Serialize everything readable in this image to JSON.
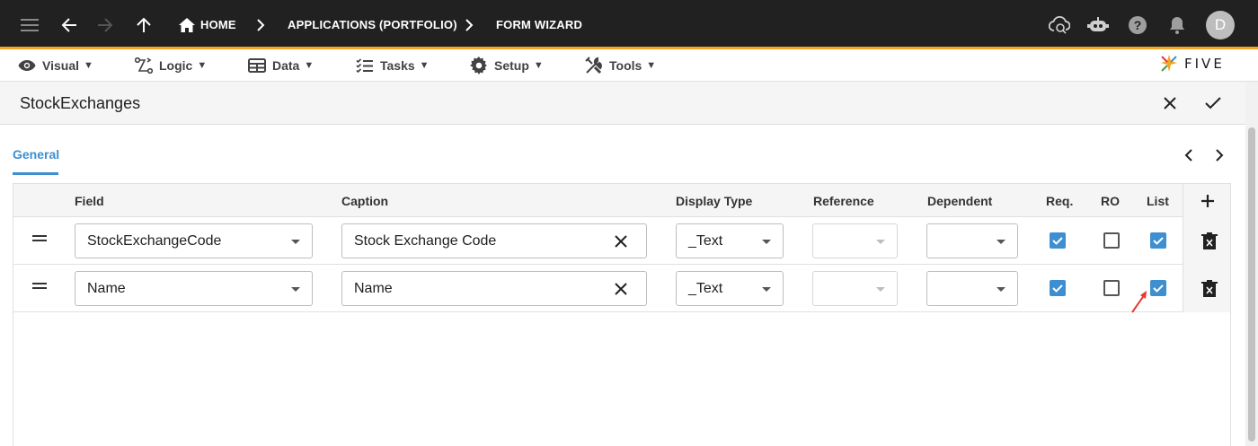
{
  "topbar": {
    "breadcrumb_home": "HOME",
    "breadcrumb_app": "APPLICATIONS (PORTFOLIO)",
    "breadcrumb_wizard": "FORM WIZARD",
    "avatar_initial": "D",
    "accent_color": "#f5a623"
  },
  "menu": {
    "items": [
      {
        "label": "Visual",
        "icon": "eye-icon"
      },
      {
        "label": "Logic",
        "icon": "logic-icon"
      },
      {
        "label": "Data",
        "icon": "table-icon"
      },
      {
        "label": "Tasks",
        "icon": "tasks-icon"
      },
      {
        "label": "Setup",
        "icon": "gear-icon"
      },
      {
        "label": "Tools",
        "icon": "tools-icon"
      }
    ],
    "logo_text": "FIVE"
  },
  "form": {
    "title": "StockExchanges",
    "tab": "General"
  },
  "grid": {
    "columns": {
      "field": "Field",
      "caption": "Caption",
      "display_type": "Display Type",
      "reference": "Reference",
      "dependent": "Dependent",
      "req": "Req.",
      "ro": "RO",
      "list": "List"
    },
    "rows": [
      {
        "field": "StockExchangeCode",
        "caption": "Stock Exchange Code",
        "display_type": "_Text",
        "reference": "",
        "dependent": "",
        "req": true,
        "ro": false,
        "list": true
      },
      {
        "field": "Name",
        "caption": "Name",
        "display_type": "_Text",
        "reference": "",
        "dependent": "",
        "req": true,
        "ro": false,
        "list": true
      }
    ]
  },
  "colors": {
    "primary": "#3d8fd1",
    "appbar": "#212121",
    "annotation_arrow": "#e53935"
  }
}
